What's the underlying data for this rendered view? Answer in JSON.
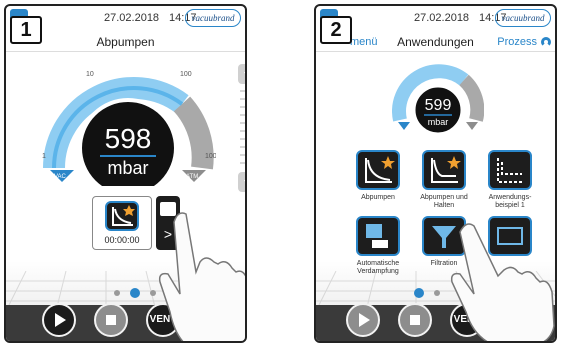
{
  "colors": {
    "accent": "#2a86c9",
    "gauge_blue": "#8fcdf2",
    "dark": "#1b1b1b",
    "border": "#222222"
  },
  "status": {
    "date": "27.02.2018",
    "time": "14:17",
    "brand": "vacuubrand"
  },
  "screen1": {
    "badge": "1",
    "title": "Abpumpen",
    "gauge": {
      "value": "598",
      "unit": "mbar",
      "ticks": [
        "1",
        "10",
        "100",
        "1000"
      ],
      "left_label": "VAC",
      "right_label": "ATM"
    },
    "tile_timer": "00:00:00",
    "slider_plus": "+",
    "slider_minus": "−",
    "buttons": {
      "play_icon": "play-icon",
      "stop_icon": "stop-icon",
      "vent": "VENT",
      "menu_icon": "star-icon"
    }
  },
  "screen2": {
    "badge": "2",
    "title": "Anwendungen",
    "back_link": "menü",
    "forward_link": "Prozess",
    "gauge": {
      "value": "599",
      "unit": "mbar"
    },
    "apps": [
      {
        "label": "Abpumpen",
        "icon": "evacuate-icon"
      },
      {
        "label": "Abpumpen und Halten",
        "icon": "evacuate-hold-icon"
      },
      {
        "label": "Anwendungs-beispiel 1",
        "icon": "application-example-icon"
      },
      {
        "label": "Automatische Verdampfung",
        "icon": "evaporation-icon"
      },
      {
        "label": "Filtration",
        "icon": "filtration-icon"
      },
      {
        "label": "",
        "icon": "drying-icon"
      }
    ],
    "buttons": {
      "play_icon": "play-icon",
      "stop_icon": "stop-icon",
      "vent": "VENT",
      "menu_icon": "star-icon"
    }
  }
}
